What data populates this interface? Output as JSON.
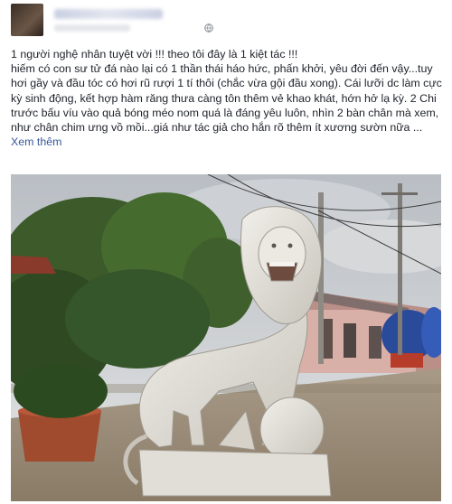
{
  "post": {
    "text": "1 người nghệ nhân tuyệt vời !!! theo tôi đây là 1 kiệt tác !!!\nhiếm có con sư tử đá nào lại có 1 thần thái háo hức, phấn khởi, yêu đời đến vậy...tuy hơi gầy và đầu tóc có hơi rũ rượi 1 tí thôi (chắc vừa gội đầu xong). Cái lưỡi dc làm cực kỳ sinh động, kết hợp hàm răng thưa càng tôn thêm vẻ khao khát, hớn hở lạ kỳ. 2 Chi trước bấu víu vào quả bóng méo nom quá là đáng yêu luôn, nhìn 2 bàn chân mà xem, như chân chim ưng vồ mồi...giá như tác giả cho hắn rõ thêm ít xương sườn nữa ...",
    "see_more": "Xem thêm"
  },
  "icons": {
    "privacy": "globe-icon"
  }
}
